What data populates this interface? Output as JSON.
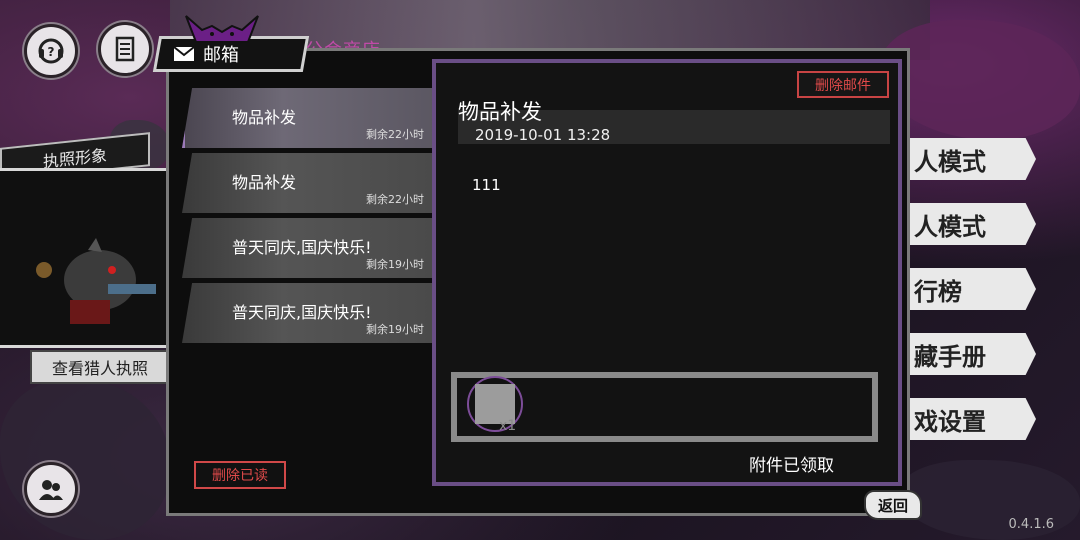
{
  "background": {
    "shop_title": "公会商店",
    "license_label": "执照形象",
    "view_license": "查看猎人执照",
    "right_menu": [
      "人模式",
      "人模式",
      "行榜",
      "藏手册",
      "戏设置"
    ],
    "version": "0.4.1.6"
  },
  "mailbox": {
    "title": "邮箱",
    "delete_read_label": "删除已读",
    "delete_mail_label": "删除邮件",
    "back_label": "返回",
    "mails": [
      {
        "subject": "物品补发",
        "remaining": "剩余22小时",
        "selected": true
      },
      {
        "subject": "物品补发",
        "remaining": "剩余22小时",
        "selected": false
      },
      {
        "subject": "普天同庆,国庆快乐!",
        "remaining": "剩余19小时",
        "selected": false
      },
      {
        "subject": "普天同庆,国庆快乐!",
        "remaining": "剩余19小时",
        "selected": false
      }
    ],
    "detail": {
      "title": "物品补发",
      "date": "2019-10-01 13:28",
      "body": "111",
      "attachment_qty": "x1",
      "attachment_status": "附件已领取"
    }
  },
  "colors": {
    "accent_purple": "#6a4e86",
    "delete_red": "#e04a4a"
  }
}
